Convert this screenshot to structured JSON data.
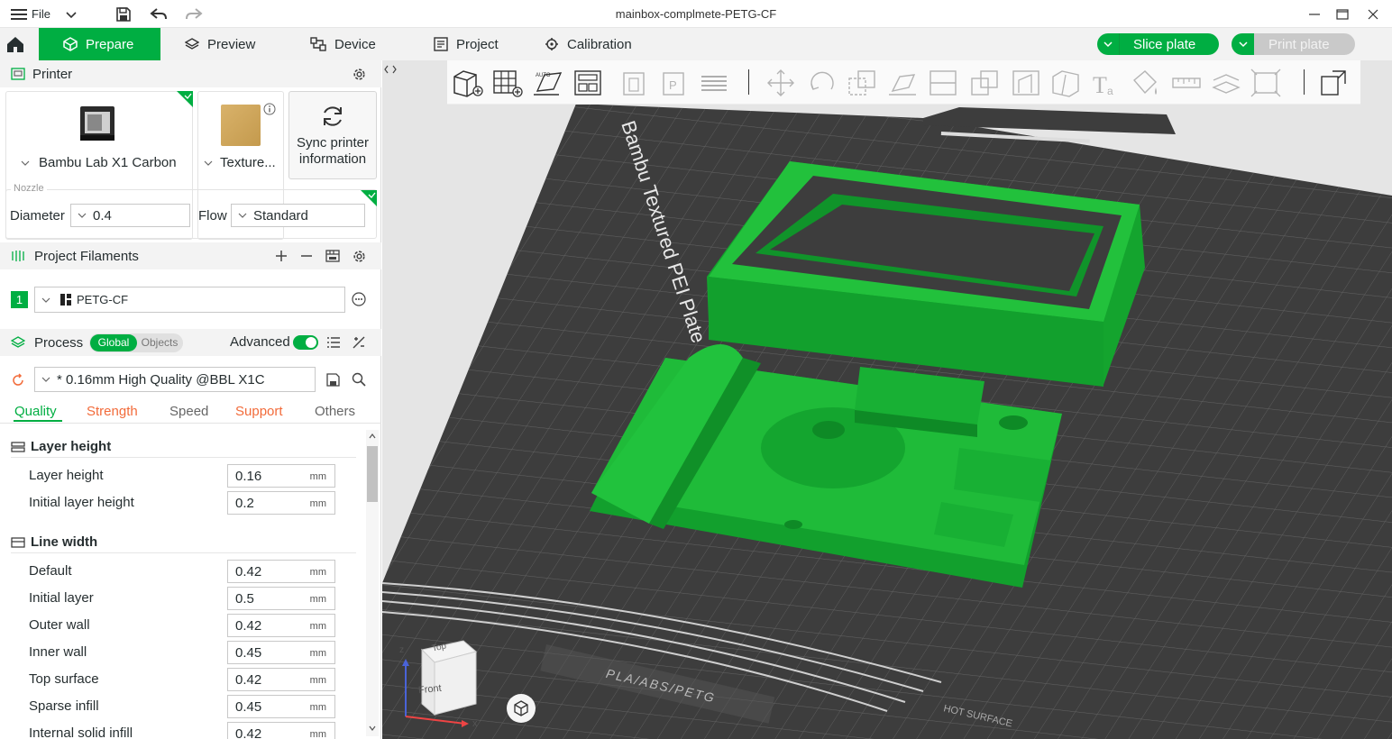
{
  "window": {
    "title": "mainbox-complmete-PETG-CF",
    "file_menu_label": "File"
  },
  "tabs": [
    {
      "label": "Prepare",
      "active": true
    },
    {
      "label": "Preview"
    },
    {
      "label": "Device"
    },
    {
      "label": "Project"
    },
    {
      "label": "Calibration"
    }
  ],
  "actions": {
    "slice_label": "Slice plate",
    "print_label": "Print plate"
  },
  "printer": {
    "section_label": "Printer",
    "printer_name": "Bambu Lab X1 Carbon",
    "plate_name": "Texture...",
    "sync_label_line1": "Sync printer",
    "sync_label_line2": "information",
    "nozzle_legend": "Nozzle",
    "diameter_label": "Diameter",
    "diameter_value": "0.4",
    "flow_label": "Flow",
    "flow_value": "Standard"
  },
  "filaments": {
    "section_label": "Project Filaments",
    "items": [
      {
        "index": "1",
        "name": "PETG-CF",
        "color": "#00ae42"
      }
    ]
  },
  "process": {
    "section_label": "Process",
    "global_label": "Global",
    "objects_label": "Objects",
    "advanced_label": "Advanced",
    "preset": "* 0.16mm High Quality @BBL X1C",
    "subtabs": [
      "Quality",
      "Strength",
      "Speed",
      "Support",
      "Others"
    ],
    "groups": [
      {
        "title": "Layer height",
        "params": [
          {
            "label": "Layer height",
            "value": "0.16",
            "unit": "mm"
          },
          {
            "label": "Initial layer height",
            "value": "0.2",
            "unit": "mm"
          }
        ]
      },
      {
        "title": "Line width",
        "params": [
          {
            "label": "Default",
            "value": "0.42",
            "unit": "mm"
          },
          {
            "label": "Initial layer",
            "value": "0.5",
            "unit": "mm"
          },
          {
            "label": "Outer wall",
            "value": "0.42",
            "unit": "mm"
          },
          {
            "label": "Inner wall",
            "value": "0.45",
            "unit": "mm"
          },
          {
            "label": "Top surface",
            "value": "0.42",
            "unit": "mm"
          },
          {
            "label": "Sparse infill",
            "value": "0.45",
            "unit": "mm"
          },
          {
            "label": "Internal solid infill",
            "value": "0.42",
            "unit": "mm"
          }
        ]
      }
    ]
  },
  "viewport": {
    "bed_text": "Bambu Textured PEI Plate",
    "bed_material_text": "PLA/ABS/PETG",
    "hot_surface_text": "HOT SURFACE",
    "cube_top": "Top",
    "cube_front": "Front",
    "axis_x": "x",
    "axis_z": "z"
  },
  "colors": {
    "accent": "#00ae42",
    "model": "#14b233",
    "bed": "#3d3d3d"
  }
}
